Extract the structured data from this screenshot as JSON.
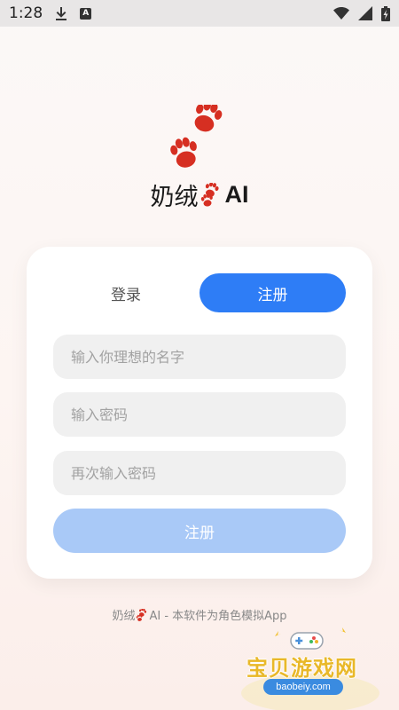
{
  "status_bar": {
    "time": "1:28",
    "icons": [
      "download-icon",
      "a-badge-icon",
      "wifi-icon",
      "signal-icon",
      "battery-charging-icon"
    ],
    "a_badge": "A"
  },
  "app": {
    "title_prefix": "奶绒",
    "title_suffix": "AI"
  },
  "tabs": {
    "login_label": "登录",
    "register_label": "注册",
    "active": "register"
  },
  "form": {
    "name_placeholder": "输入你理想的名字",
    "password_placeholder": "输入密码",
    "confirm_placeholder": "再次输入密码",
    "submit_label": "注册"
  },
  "footer": {
    "prefix": "奶绒",
    "suffix": "AI - 本软件为角色模拟App"
  },
  "watermark": {
    "text": "宝贝游戏网",
    "url": "baobeiy.com"
  },
  "colors": {
    "accent": "#2e7df6",
    "accent_disabled": "#a9c9f7",
    "paw": "#d62f22",
    "field_bg": "#f0f0f0"
  }
}
